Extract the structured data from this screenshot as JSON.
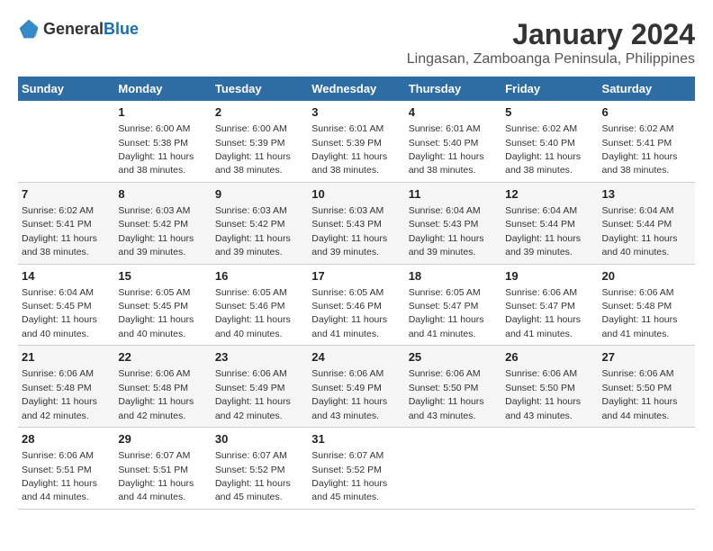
{
  "header": {
    "logo_general": "General",
    "logo_blue": "Blue",
    "main_title": "January 2024",
    "subtitle": "Lingasan, Zamboanga Peninsula, Philippines"
  },
  "calendar": {
    "days_of_week": [
      "Sunday",
      "Monday",
      "Tuesday",
      "Wednesday",
      "Thursday",
      "Friday",
      "Saturday"
    ],
    "weeks": [
      [
        {
          "day": "",
          "content": ""
        },
        {
          "day": "1",
          "content": "Sunrise: 6:00 AM\nSunset: 5:38 PM\nDaylight: 11 hours\nand 38 minutes."
        },
        {
          "day": "2",
          "content": "Sunrise: 6:00 AM\nSunset: 5:39 PM\nDaylight: 11 hours\nand 38 minutes."
        },
        {
          "day": "3",
          "content": "Sunrise: 6:01 AM\nSunset: 5:39 PM\nDaylight: 11 hours\nand 38 minutes."
        },
        {
          "day": "4",
          "content": "Sunrise: 6:01 AM\nSunset: 5:40 PM\nDaylight: 11 hours\nand 38 minutes."
        },
        {
          "day": "5",
          "content": "Sunrise: 6:02 AM\nSunset: 5:40 PM\nDaylight: 11 hours\nand 38 minutes."
        },
        {
          "day": "6",
          "content": "Sunrise: 6:02 AM\nSunset: 5:41 PM\nDaylight: 11 hours\nand 38 minutes."
        }
      ],
      [
        {
          "day": "7",
          "content": "Sunrise: 6:02 AM\nSunset: 5:41 PM\nDaylight: 11 hours\nand 38 minutes."
        },
        {
          "day": "8",
          "content": "Sunrise: 6:03 AM\nSunset: 5:42 PM\nDaylight: 11 hours\nand 39 minutes."
        },
        {
          "day": "9",
          "content": "Sunrise: 6:03 AM\nSunset: 5:42 PM\nDaylight: 11 hours\nand 39 minutes."
        },
        {
          "day": "10",
          "content": "Sunrise: 6:03 AM\nSunset: 5:43 PM\nDaylight: 11 hours\nand 39 minutes."
        },
        {
          "day": "11",
          "content": "Sunrise: 6:04 AM\nSunset: 5:43 PM\nDaylight: 11 hours\nand 39 minutes."
        },
        {
          "day": "12",
          "content": "Sunrise: 6:04 AM\nSunset: 5:44 PM\nDaylight: 11 hours\nand 39 minutes."
        },
        {
          "day": "13",
          "content": "Sunrise: 6:04 AM\nSunset: 5:44 PM\nDaylight: 11 hours\nand 40 minutes."
        }
      ],
      [
        {
          "day": "14",
          "content": "Sunrise: 6:04 AM\nSunset: 5:45 PM\nDaylight: 11 hours\nand 40 minutes."
        },
        {
          "day": "15",
          "content": "Sunrise: 6:05 AM\nSunset: 5:45 PM\nDaylight: 11 hours\nand 40 minutes."
        },
        {
          "day": "16",
          "content": "Sunrise: 6:05 AM\nSunset: 5:46 PM\nDaylight: 11 hours\nand 40 minutes."
        },
        {
          "day": "17",
          "content": "Sunrise: 6:05 AM\nSunset: 5:46 PM\nDaylight: 11 hours\nand 41 minutes."
        },
        {
          "day": "18",
          "content": "Sunrise: 6:05 AM\nSunset: 5:47 PM\nDaylight: 11 hours\nand 41 minutes."
        },
        {
          "day": "19",
          "content": "Sunrise: 6:06 AM\nSunset: 5:47 PM\nDaylight: 11 hours\nand 41 minutes."
        },
        {
          "day": "20",
          "content": "Sunrise: 6:06 AM\nSunset: 5:48 PM\nDaylight: 11 hours\nand 41 minutes."
        }
      ],
      [
        {
          "day": "21",
          "content": "Sunrise: 6:06 AM\nSunset: 5:48 PM\nDaylight: 11 hours\nand 42 minutes."
        },
        {
          "day": "22",
          "content": "Sunrise: 6:06 AM\nSunset: 5:48 PM\nDaylight: 11 hours\nand 42 minutes."
        },
        {
          "day": "23",
          "content": "Sunrise: 6:06 AM\nSunset: 5:49 PM\nDaylight: 11 hours\nand 42 minutes."
        },
        {
          "day": "24",
          "content": "Sunrise: 6:06 AM\nSunset: 5:49 PM\nDaylight: 11 hours\nand 43 minutes."
        },
        {
          "day": "25",
          "content": "Sunrise: 6:06 AM\nSunset: 5:50 PM\nDaylight: 11 hours\nand 43 minutes."
        },
        {
          "day": "26",
          "content": "Sunrise: 6:06 AM\nSunset: 5:50 PM\nDaylight: 11 hours\nand 43 minutes."
        },
        {
          "day": "27",
          "content": "Sunrise: 6:06 AM\nSunset: 5:50 PM\nDaylight: 11 hours\nand 44 minutes."
        }
      ],
      [
        {
          "day": "28",
          "content": "Sunrise: 6:06 AM\nSunset: 5:51 PM\nDaylight: 11 hours\nand 44 minutes."
        },
        {
          "day": "29",
          "content": "Sunrise: 6:07 AM\nSunset: 5:51 PM\nDaylight: 11 hours\nand 44 minutes."
        },
        {
          "day": "30",
          "content": "Sunrise: 6:07 AM\nSunset: 5:52 PM\nDaylight: 11 hours\nand 45 minutes."
        },
        {
          "day": "31",
          "content": "Sunrise: 6:07 AM\nSunset: 5:52 PM\nDaylight: 11 hours\nand 45 minutes."
        },
        {
          "day": "",
          "content": ""
        },
        {
          "day": "",
          "content": ""
        },
        {
          "day": "",
          "content": ""
        }
      ]
    ]
  }
}
